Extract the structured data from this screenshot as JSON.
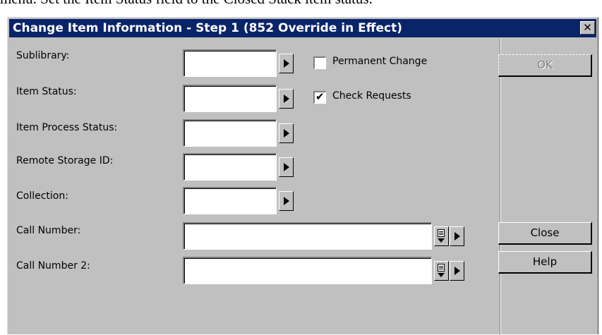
{
  "document": {
    "text": "menu. Set the Item Status field to the Closed Stack item status."
  },
  "dialog": {
    "title": "Change Item Information - Step 1 (852 Override in Effect)",
    "close_glyph": "✕",
    "labels": {
      "sublibrary": "Sublibrary:",
      "item_status": "Item Status:",
      "item_process_status": "Item Process Status:",
      "remote_storage_id": "Remote Storage ID:",
      "collection": "Collection:",
      "call_number": "Call Number:",
      "call_number_2": "Call Number 2:"
    },
    "values": {
      "sublibrary": "",
      "item_status": "",
      "item_process_status": "",
      "remote_storage_id": "",
      "collection": "",
      "call_number": "",
      "call_number_2": ""
    },
    "checkboxes": {
      "permanent_change": {
        "label": "Permanent Change",
        "checked": false
      },
      "check_requests": {
        "label": "Check Requests",
        "checked": true
      }
    },
    "buttons": {
      "ok": "OK",
      "close": "Close",
      "help": "Help"
    },
    "icons": {
      "arrow": "right-arrow-icon",
      "list": "list-dropdown-icon"
    },
    "colors": {
      "title_bar": "#0a246a",
      "face": "#c0c0c0"
    }
  }
}
